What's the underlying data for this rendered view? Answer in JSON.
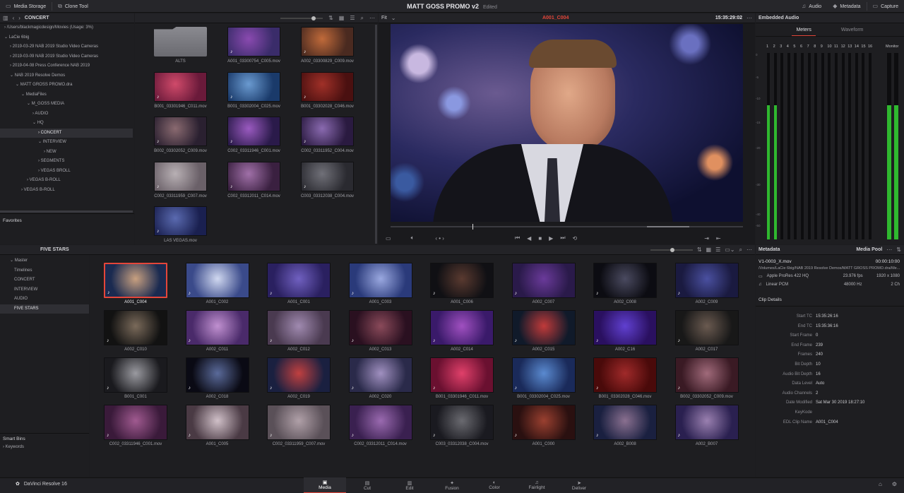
{
  "topbar": {
    "media_storage": "Media Storage",
    "clone_tool": "Clone Tool",
    "project_title": "MATT GOSS PROMO v2",
    "edited": "Edited",
    "audio": "Audio",
    "metadata": "Metadata",
    "capture": "Capture"
  },
  "media_storage": {
    "header": "CONCERT",
    "tree": [
      {
        "label": "/Users/blackmagicdesign/Movies (Usage: 3%)",
        "indent": 0,
        "arrow": "›"
      },
      {
        "label": "LaCie 6big",
        "indent": 0,
        "arrow": "⌄"
      },
      {
        "label": "2019-03-29 NAB 2019 Studio Video Cameras",
        "indent": 1,
        "arrow": "›"
      },
      {
        "label": "2019-03-09 NAB 2019 Studio Video Cameras",
        "indent": 1,
        "arrow": "›"
      },
      {
        "label": "2019-04-08 Press Conference NAB 2019",
        "indent": 1,
        "arrow": "›"
      },
      {
        "label": "NAB 2019 Resolve Demos",
        "indent": 1,
        "arrow": "⌄"
      },
      {
        "label": "MATT GROSS PROMO.dra",
        "indent": 2,
        "arrow": "⌄"
      },
      {
        "label": "MediaFiles",
        "indent": 3,
        "arrow": "⌄"
      },
      {
        "label": "M_GOSS MEDIA",
        "indent": 4,
        "arrow": "⌄"
      },
      {
        "label": "AUDIO",
        "indent": 5,
        "arrow": "›"
      },
      {
        "label": "HQ",
        "indent": 5,
        "arrow": "⌄"
      },
      {
        "label": "CONCERT",
        "indent": 6,
        "arrow": "›",
        "selected": true
      },
      {
        "label": "INTERVIEW",
        "indent": 6,
        "arrow": "⌄"
      },
      {
        "label": "NEW",
        "indent": 7,
        "arrow": "›"
      },
      {
        "label": "SEGMENTS",
        "indent": 6,
        "arrow": "›"
      },
      {
        "label": "VEGAS BROLL",
        "indent": 6,
        "arrow": "›"
      },
      {
        "label": "VEGAS B-ROLL",
        "indent": 4,
        "arrow": "›"
      },
      {
        "label": "VEGAS B-ROLL",
        "indent": 3,
        "arrow": "›"
      }
    ],
    "favorites": "Favorites",
    "files": [
      {
        "name": "ALTS",
        "folder": true
      },
      {
        "name": "A001_03300754_C005.mov",
        "c1": "#3a2c6a",
        "c2": "#8a4ab0"
      },
      {
        "name": "A002_03300829_C009.mov",
        "c1": "#4a2a20",
        "c2": "#c06a3a"
      },
      {
        "name": "B001_03301946_C011.mov",
        "c1": "#6a1a3a",
        "c2": "#d04a6a"
      },
      {
        "name": "B001_03302004_C025.mov",
        "c1": "#1a3a6a",
        "c2": "#6a9ad0"
      },
      {
        "name": "B001_03302028_C046.mov",
        "c1": "#4a1010",
        "c2": "#a03028"
      },
      {
        "name": "B002_03302052_C009.mov",
        "c1": "#2a2030",
        "c2": "#8a6a70"
      },
      {
        "name": "C002_03311946_C001.mov",
        "c1": "#2a1a4a",
        "c2": "#9a5ac0"
      },
      {
        "name": "C002_03311952_C004.mov",
        "c1": "#2a1a40",
        "c2": "#8a6ab0"
      },
      {
        "name": "C002_03311959_C007.mov",
        "c1": "#6a6068",
        "c2": "#b8b0b4"
      },
      {
        "name": "C002_03312011_C014.mov",
        "c1": "#3a2040",
        "c2": "#a070a8"
      },
      {
        "name": "C003_03312038_C004.mov",
        "c1": "#2a2a30",
        "c2": "#707078"
      },
      {
        "name": "LAS VEGAS.mov",
        "c1": "#1a2050",
        "c2": "#5a6ab0"
      }
    ]
  },
  "viewer": {
    "fit": "Fit",
    "clip_name": "A001_C004",
    "timecode": "15:35:29:02"
  },
  "audio_panel": {
    "header": "Embedded Audio",
    "tab_meters": "Meters",
    "tab_waveform": "Waveform",
    "monitor": "Monitor",
    "channels": [
      "1",
      "2",
      "3",
      "4",
      "5",
      "6",
      "7",
      "8",
      "9",
      "10",
      "11",
      "12",
      "13",
      "14",
      "15",
      "16"
    ],
    "scale": [
      "0",
      "-5",
      "-10",
      "-15",
      "-20",
      "-30",
      "-40",
      "-50"
    ],
    "levels": [
      0.72,
      0.72,
      0,
      0,
      0,
      0,
      0,
      0,
      0,
      0,
      0,
      0,
      0,
      0,
      0,
      0
    ],
    "monitor_levels": [
      0.72,
      0.72
    ]
  },
  "media_pool": {
    "header": "FIVE STARS",
    "bins": [
      {
        "label": "Master"
      },
      {
        "label": "Timelines"
      },
      {
        "label": "CONCERT"
      },
      {
        "label": "INTERVIEW"
      },
      {
        "label": "AUDIO"
      },
      {
        "label": "FIVE STARS",
        "selected": true
      }
    ],
    "smart_bins": "Smart Bins",
    "keywords": "Keywords",
    "clips": [
      {
        "name": "A001_C004",
        "c1": "#1a2a50",
        "c2": "#c8a080",
        "sel": true
      },
      {
        "name": "A001_C002",
        "c1": "#3a4a8a",
        "c2": "#d0d8f0"
      },
      {
        "name": "A001_C001",
        "c1": "#2a2060",
        "c2": "#7060c0"
      },
      {
        "name": "A001_C003",
        "c1": "#2a3a7a",
        "c2": "#9aa8e0"
      },
      {
        "name": "A001_C006",
        "c1": "#101014",
        "c2": "#5a3a30"
      },
      {
        "name": "A002_C007",
        "c1": "#2a1a4a",
        "c2": "#6a3a9a"
      },
      {
        "name": "A002_C008",
        "c1": "#0c0c12",
        "c2": "#4a4a60"
      },
      {
        "name": "A002_C009",
        "c1": "#1a1a40",
        "c2": "#4a50a0"
      },
      {
        "name": "A002_C010",
        "c1": "#121212",
        "c2": "#7a6a5a"
      },
      {
        "name": "A002_C011",
        "c1": "#4a2a6a",
        "c2": "#c090d0"
      },
      {
        "name": "A002_C012",
        "c1": "#4a3a50",
        "c2": "#a08ab0"
      },
      {
        "name": "A002_C013",
        "c1": "#2a1020",
        "c2": "#8a4a5a"
      },
      {
        "name": "A002_C014",
        "c1": "#3a1a6a",
        "c2": "#a050c0"
      },
      {
        "name": "A002_C015",
        "c1": "#101a2a",
        "c2": "#c03a3a"
      },
      {
        "name": "A002_C16",
        "c1": "#2a1060",
        "c2": "#6040d0"
      },
      {
        "name": "A002_C017",
        "c1": "#181818",
        "c2": "#6a5a50"
      },
      {
        "name": "B001_C001",
        "c1": "#1a1a1e",
        "c2": "#9a9aa0"
      },
      {
        "name": "A002_C018",
        "c1": "#0a0a14",
        "c2": "#5a6a9a"
      },
      {
        "name": "A002_C019",
        "c1": "#1a2040",
        "c2": "#c04040"
      },
      {
        "name": "A002_C020",
        "c1": "#2a2a4a",
        "c2": "#a090c0"
      },
      {
        "name": "B001_03301946_C011.mov",
        "c1": "#6a1030",
        "c2": "#e0406a"
      },
      {
        "name": "B001_03302004_C025.mov",
        "c1": "#1a2a5a",
        "c2": "#5a8ad0"
      },
      {
        "name": "B001_03302028_C046.mov",
        "c1": "#4a0a0a",
        "c2": "#a02a2a"
      },
      {
        "name": "B002_03302052_C009.mov",
        "c1": "#3a1a24",
        "c2": "#a06a7a"
      },
      {
        "name": "C002_03311946_C001.mov",
        "c1": "#3a1a3a",
        "c2": "#a05a90"
      },
      {
        "name": "A001_C005",
        "c1": "#4a3a44",
        "c2": "#d0c0c8"
      },
      {
        "name": "C002_03311959_C007.mov",
        "c1": "#5a5058",
        "c2": "#b0a0a8"
      },
      {
        "name": "C002_03312011_C014.mov",
        "c1": "#3a2050",
        "c2": "#9a6ab0"
      },
      {
        "name": "C003_03312038_C004.mov",
        "c1": "#1a1a20",
        "c2": "#6a6a70"
      },
      {
        "name": "A001_C000",
        "c1": "#2a1010",
        "c2": "#9a4030"
      },
      {
        "name": "A002_B008",
        "c1": "#1a2040",
        "c2": "#8a7090"
      },
      {
        "name": "A002_B007",
        "c1": "#2a2050",
        "c2": "#9a80b0"
      }
    ]
  },
  "metadata_panel": {
    "header": "Metadata",
    "pool_tab": "Media Pool",
    "filename": "V1-0003_X.mov",
    "duration": "00:00:10:00",
    "path": "/Volumes/LaCie 6big/NAB 2019 Resolve Demos/MATT GROSS PROMO.dra/Me...",
    "codec": "Apple ProRes 422 HQ",
    "fps": "23.976 fps",
    "resolution": "1920 x 1080",
    "audio_codec": "Linear PCM",
    "sample_rate": "48000 Hz",
    "channels": "2 Ch",
    "clip_details": "Clip Details",
    "details": [
      {
        "k": "Start TC",
        "v": "15:35:26:16"
      },
      {
        "k": "End TC",
        "v": "15:35:36:16"
      },
      {
        "k": "Start Frame",
        "v": "0"
      },
      {
        "k": "End Frame",
        "v": "239"
      },
      {
        "k": "Frames",
        "v": "240"
      },
      {
        "k": "Bit Depth",
        "v": "10"
      },
      {
        "k": "Audio Bit Depth",
        "v": "16"
      },
      {
        "k": "Data Level",
        "v": "Auto"
      },
      {
        "k": "Audio Channels",
        "v": "2"
      },
      {
        "k": "Date Modified",
        "v": "Sat Mar 30 2019 18:27:10"
      },
      {
        "k": "KeyKode",
        "v": ""
      },
      {
        "k": "EDL Clip Name",
        "v": "A001_C004"
      }
    ]
  },
  "bottom": {
    "app_name": "DaVinci Resolve 16",
    "pages": [
      {
        "label": "Media",
        "active": true
      },
      {
        "label": "Cut"
      },
      {
        "label": "Edit"
      },
      {
        "label": "Fusion"
      },
      {
        "label": "Color"
      },
      {
        "label": "Fairlight"
      },
      {
        "label": "Deliver"
      }
    ]
  },
  "colors": {
    "accent_red": "#e4463a",
    "meter_green": "#2fb82f"
  }
}
